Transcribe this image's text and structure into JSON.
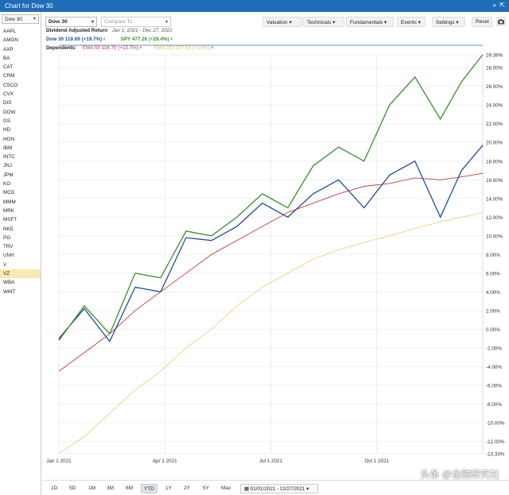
{
  "window": {
    "title": "Chart for Dow 30",
    "controls": [
      "»",
      "⇱"
    ]
  },
  "sidebar": {
    "index_select": "Dow 30",
    "items": [
      "AAPL",
      "AMGN",
      "AXP",
      "BA",
      "CAT",
      "CRM",
      "CSCO",
      "CVX",
      "DIS",
      "DOW",
      "GS",
      "HD",
      "HON",
      "IBM",
      "INTC",
      "JNJ",
      "JPM",
      "KO",
      "MCD",
      "MMM",
      "MRK",
      "MSFT",
      "NKE",
      "PG",
      "TRV",
      "UNH",
      "V",
      "VZ",
      "WBA",
      "WMT"
    ],
    "selected": "VZ"
  },
  "toolbar": {
    "symbol": "Dow 30",
    "compare_placeholder": "Compare To",
    "buttons": [
      "Valuation",
      "Technicals",
      "Fundamentals",
      "Events",
      "Settings"
    ],
    "reset": "Reset"
  },
  "chart_header": {
    "subtitle": "Dividend Adjusted Return",
    "period": "Jan 1, 2021 - Dec 27, 2021",
    "series_labels": [
      "Dow 30 119.69 (+19.7%)",
      "SPY 477.26 (+29.4%)"
    ],
    "dependents_label": "Dependents:",
    "dependents": [
      "EMA 50 116.70 (+15.7%)",
      "EMA 200 107.60 (+2.8%)"
    ],
    "close_mark": "×"
  },
  "chart_data": {
    "type": "line",
    "x_ticks": [
      "Jan 1 2021",
      "Apr 1 2021",
      "Jul 1 2021",
      "Oct 1 2021"
    ],
    "y_ticks": [
      "29.38%",
      "28.00%",
      "26.00%",
      "24.00%",
      "22.00%",
      "20.00%",
      "18.00%",
      "16.00%",
      "14.00%",
      "12.00%",
      "10.00%",
      "8.00%",
      "6.00%",
      "4.00%",
      "2.00%",
      "0.00%",
      "-2.00%",
      "-4.00%",
      "-6.00%",
      "-8.00%",
      "-10.00%",
      "-12.00%",
      "-13.33%"
    ],
    "ylim": [
      -13.33,
      29.38
    ],
    "x": [
      0,
      0.06,
      0.12,
      0.18,
      0.24,
      0.3,
      0.36,
      0.42,
      0.48,
      0.54,
      0.6,
      0.66,
      0.72,
      0.78,
      0.84,
      0.9,
      0.95,
      1.0
    ],
    "series": [
      {
        "name": "SPY",
        "color": "#3a8d2f",
        "values": [
          -1.2,
          2.5,
          -0.5,
          6.0,
          5.5,
          10.5,
          10.0,
          12.0,
          14.5,
          13.0,
          17.5,
          19.5,
          18.0,
          24.0,
          27.0,
          22.5,
          26.5,
          29.4
        ]
      },
      {
        "name": "Dow 30",
        "color": "#1f4e96",
        "values": [
          -1.0,
          2.2,
          -1.3,
          4.5,
          4.0,
          9.8,
          9.5,
          11.0,
          13.5,
          12.0,
          14.5,
          16.0,
          13.0,
          16.5,
          18.0,
          12.0,
          17.0,
          19.7
        ]
      },
      {
        "name": "EMA 50",
        "color": "#c43a3a",
        "values": [
          -4.5,
          -2.5,
          -0.5,
          2.0,
          4.0,
          6.0,
          8.0,
          9.5,
          11.0,
          12.5,
          13.5,
          14.5,
          15.3,
          15.6,
          16.2,
          16.0,
          16.3,
          16.7
        ]
      },
      {
        "name": "EMA 200",
        "color": "#f2d27a",
        "values": [
          -13.3,
          -11.5,
          -9.0,
          -6.5,
          -4.5,
          -2.0,
          0.0,
          2.5,
          4.5,
          6.0,
          7.5,
          8.5,
          9.3,
          10.0,
          10.8,
          11.5,
          12.0,
          12.5
        ]
      }
    ],
    "grid": true,
    "legend_position": "top-left"
  },
  "bottombar": {
    "ranges": [
      "1D",
      "5D",
      "1M",
      "3M",
      "6M",
      "YTD",
      "1Y",
      "2Y",
      "5Y",
      "Max"
    ],
    "selected": "YTD",
    "date_range": "01/01/2021 - 12/27/2021"
  },
  "watermark": "头条 @金融研究社"
}
